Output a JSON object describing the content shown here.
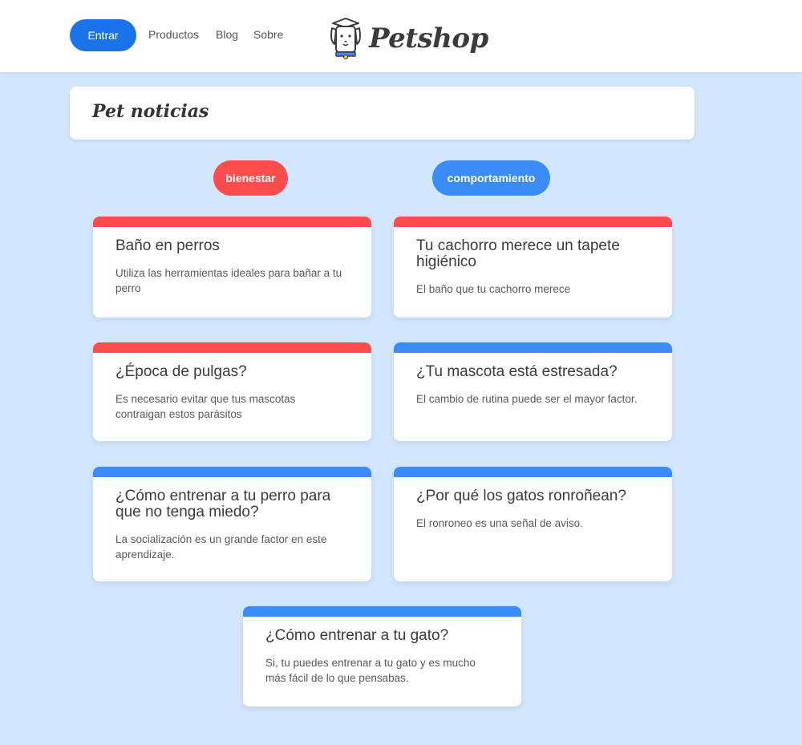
{
  "header": {
    "login_label": "Entrar",
    "nav": [
      "Productos",
      "Blog",
      "Sobre"
    ],
    "logo_text": "Petshop"
  },
  "page": {
    "title": "Pet noticias"
  },
  "categories": [
    {
      "label": "bienestar",
      "color": "#ff4c4c"
    },
    {
      "label": "comportamiento",
      "color": "#3a8df8"
    }
  ],
  "cards": [
    {
      "title": "Baño en perros",
      "text": "Utiliza las herramientas ideales para bañar a tu perro",
      "category": "bienestar"
    },
    {
      "title": "Tu cachorro merece un tapete higiénico",
      "text": "El baño que tu cachorro merece",
      "category": "bienestar"
    },
    {
      "title": "¿Época de pulgas?",
      "text": "Es necesario evitar que tus mascotas contraigan estos parásitos",
      "category": "bienestar"
    },
    {
      "title": "¿Tu mascota está estresada?",
      "text": "El cambio de rutina puede ser el mayor factor.",
      "category": "comportamiento"
    },
    {
      "title": "¿Cómo entrenar a tu perro para que no tenga miedo?",
      "text": "La socialización es un grande factor en este aprendizaje.",
      "category": "comportamiento"
    },
    {
      "title": "¿Por qué los gatos ronroñean?",
      "text": "El ronroneo es una señal de aviso.",
      "category": "comportamiento"
    },
    {
      "title": "¿Cómo entrenar a tu gato?",
      "text": "Si, tu puedes entrenar a tu gato y es mucho más fácil de lo que pensabas.",
      "category": "comportamiento"
    }
  ],
  "colors": {
    "background": "#d2e6fd",
    "primary_button": "#1a73e8",
    "bienestar": "#ff4c4c",
    "comportamiento": "#3a8df8"
  }
}
